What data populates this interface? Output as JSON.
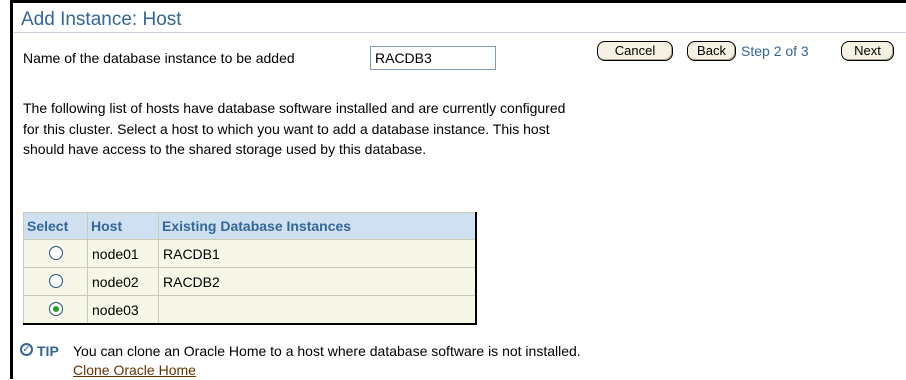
{
  "header": {
    "title": "Add Instance: Host"
  },
  "name_field": {
    "label": "Name of the database instance to be added",
    "value": "RACDB3"
  },
  "navigation": {
    "cancel_label": "Cancel",
    "back_label": "Back",
    "step_text": "Step 2 of 3",
    "next_label": "Next"
  },
  "description": "The following list of hosts have database software installed and are currently configured for this cluster. Select a host to which you want to add a database instance. This host should have access to the shared storage used by this database.",
  "table": {
    "headers": [
      "Select",
      "Host",
      "Existing Database Instances"
    ],
    "rows": [
      {
        "host": "node01",
        "instances": "RACDB1",
        "selected": false
      },
      {
        "host": "node02",
        "instances": "RACDB2",
        "selected": false
      },
      {
        "host": "node03",
        "instances": "",
        "selected": true
      }
    ]
  },
  "tip": {
    "label": "TIP",
    "text": "You can clone an Oracle Home to a host where database software is not installed.",
    "link_label": "Clone Oracle Home"
  },
  "colors": {
    "title": "#336699",
    "table_header_bg": "#cfe0f1",
    "table_row_bg": "#f7f7e7",
    "link": "#663300",
    "radio_selected": "#21a121"
  }
}
